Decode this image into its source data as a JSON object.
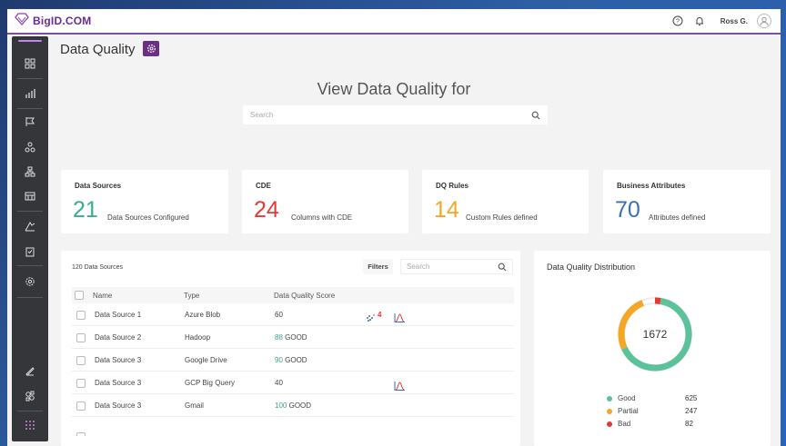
{
  "app": {
    "brand": "BigID.COM",
    "user": "Ross G."
  },
  "page": {
    "title": "Data Quality",
    "hero": "View Data Quality for",
    "search_placeholder": "Search"
  },
  "cards": [
    {
      "label": "Data Sources",
      "number": "21",
      "desc": "Data Sources Configured",
      "color": "#3aae8c"
    },
    {
      "label": "CDE",
      "number": "24",
      "desc": "Columns with CDE",
      "color": "#e53935"
    },
    {
      "label": "DQ Rules",
      "number": "14",
      "desc": "Custom Rules defined",
      "color": "#f5a623"
    },
    {
      "label": "Business Attributes",
      "number": "70",
      "desc": "Attributes defined",
      "color": "#3a6fb5"
    }
  ],
  "table": {
    "count": "120 Data Sources",
    "filters": "Filters",
    "search_placeholder": "Search",
    "headers": {
      "name": "Name",
      "type": "Type",
      "score": "Data Quality Score"
    },
    "rows": [
      {
        "name": "Data Source 1",
        "type": "Azure Blob",
        "score": "60",
        "status": "",
        "alerts": "4"
      },
      {
        "name": "Data Source 2",
        "type": "Hadoop",
        "score": "88",
        "status": "GOOD",
        "alerts": ""
      },
      {
        "name": "Data Source 3",
        "type": "Google Drive",
        "score": "90",
        "status": "GOOD",
        "alerts": ""
      },
      {
        "name": "Data Source 3",
        "type": "GCP Big Query",
        "score": "40",
        "status": "",
        "alerts": ""
      },
      {
        "name": "Data Source 3",
        "type": "Gmail",
        "score": "100",
        "status": "GOOD",
        "alerts": ""
      }
    ]
  },
  "distribution": {
    "title": "Data Quality Distribution",
    "total": "1672",
    "legend": [
      {
        "label": "Good",
        "value": "625",
        "color": "#5cc29a"
      },
      {
        "label": "Partial",
        "value": "247",
        "color": "#f5a623"
      },
      {
        "label": "Bad",
        "value": "82",
        "color": "#e53935"
      }
    ]
  }
}
